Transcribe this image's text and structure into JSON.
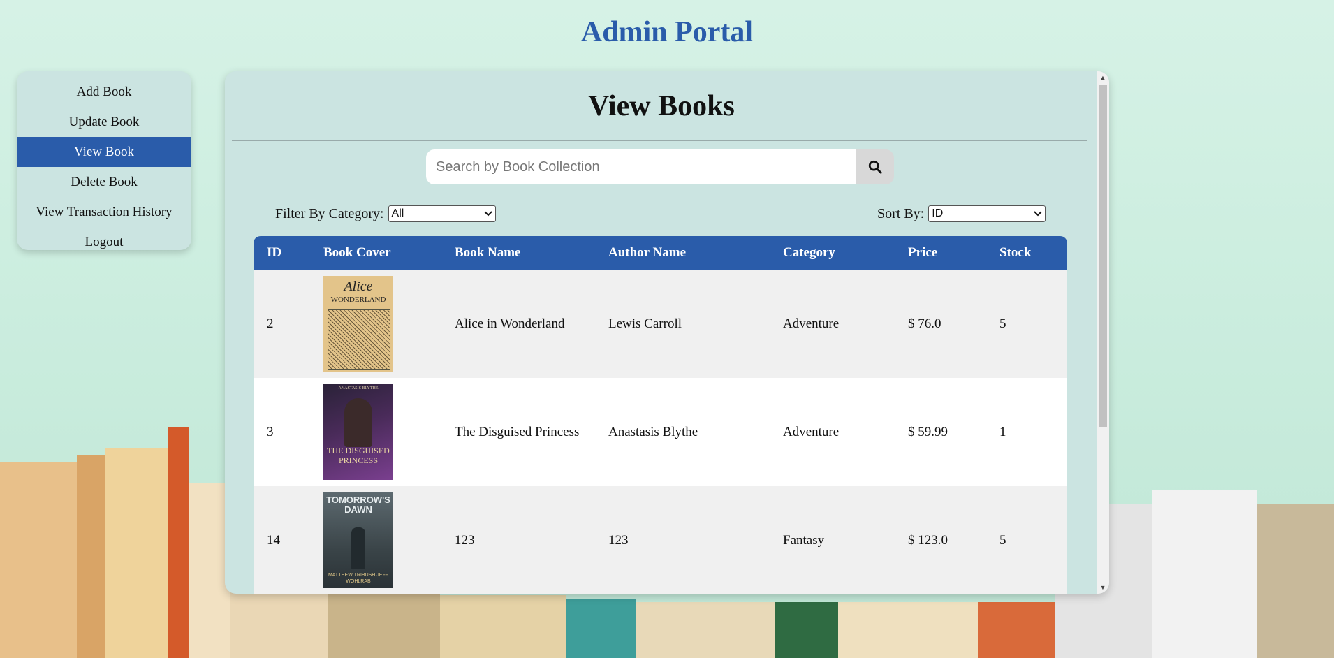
{
  "header": {
    "title": "Admin Portal"
  },
  "sidebar": {
    "items": [
      {
        "label": "Add Book"
      },
      {
        "label": "Update Book"
      },
      {
        "label": "View Book",
        "active": true
      },
      {
        "label": "Delete Book"
      },
      {
        "label": "View Transaction History"
      },
      {
        "label": "Logout"
      }
    ]
  },
  "main": {
    "title": "View Books",
    "search": {
      "placeholder": "Search by Book Collection",
      "value": "",
      "icon": "search-icon"
    },
    "filter": {
      "label": "Filter By Category:",
      "selected": "All"
    },
    "sort": {
      "label": "Sort By:",
      "selected": "ID"
    },
    "table": {
      "columns": [
        "ID",
        "Book Cover",
        "Book Name",
        "Author Name",
        "Category",
        "Price",
        "Stock"
      ],
      "rows": [
        {
          "id": "2",
          "cover_lines": [
            "Alice",
            "WONDERLAND"
          ],
          "name": "Alice in Wonderland",
          "author": "Lewis Carroll",
          "category": "Adventure",
          "price": "$ 76.0",
          "stock": "5"
        },
        {
          "id": "3",
          "cover_lines": [
            "ANASTASIS BLYTHE",
            "THE DISGUISED PRINCESS"
          ],
          "name": "The Disguised Princess",
          "author": "Anastasis Blythe",
          "category": "Adventure",
          "price": "$ 59.99",
          "stock": "1"
        },
        {
          "id": "14",
          "cover_lines": [
            "TOMORROW'S DAWN",
            "MATTHEW TRIBUSH JEFF WOHLRAB"
          ],
          "name": "123",
          "author": "123",
          "category": "Fantasy",
          "price": "$ 123.0",
          "stock": "5"
        }
      ]
    }
  },
  "colors": {
    "accent": "#2a5caa",
    "panel": "#cbe4e1"
  }
}
